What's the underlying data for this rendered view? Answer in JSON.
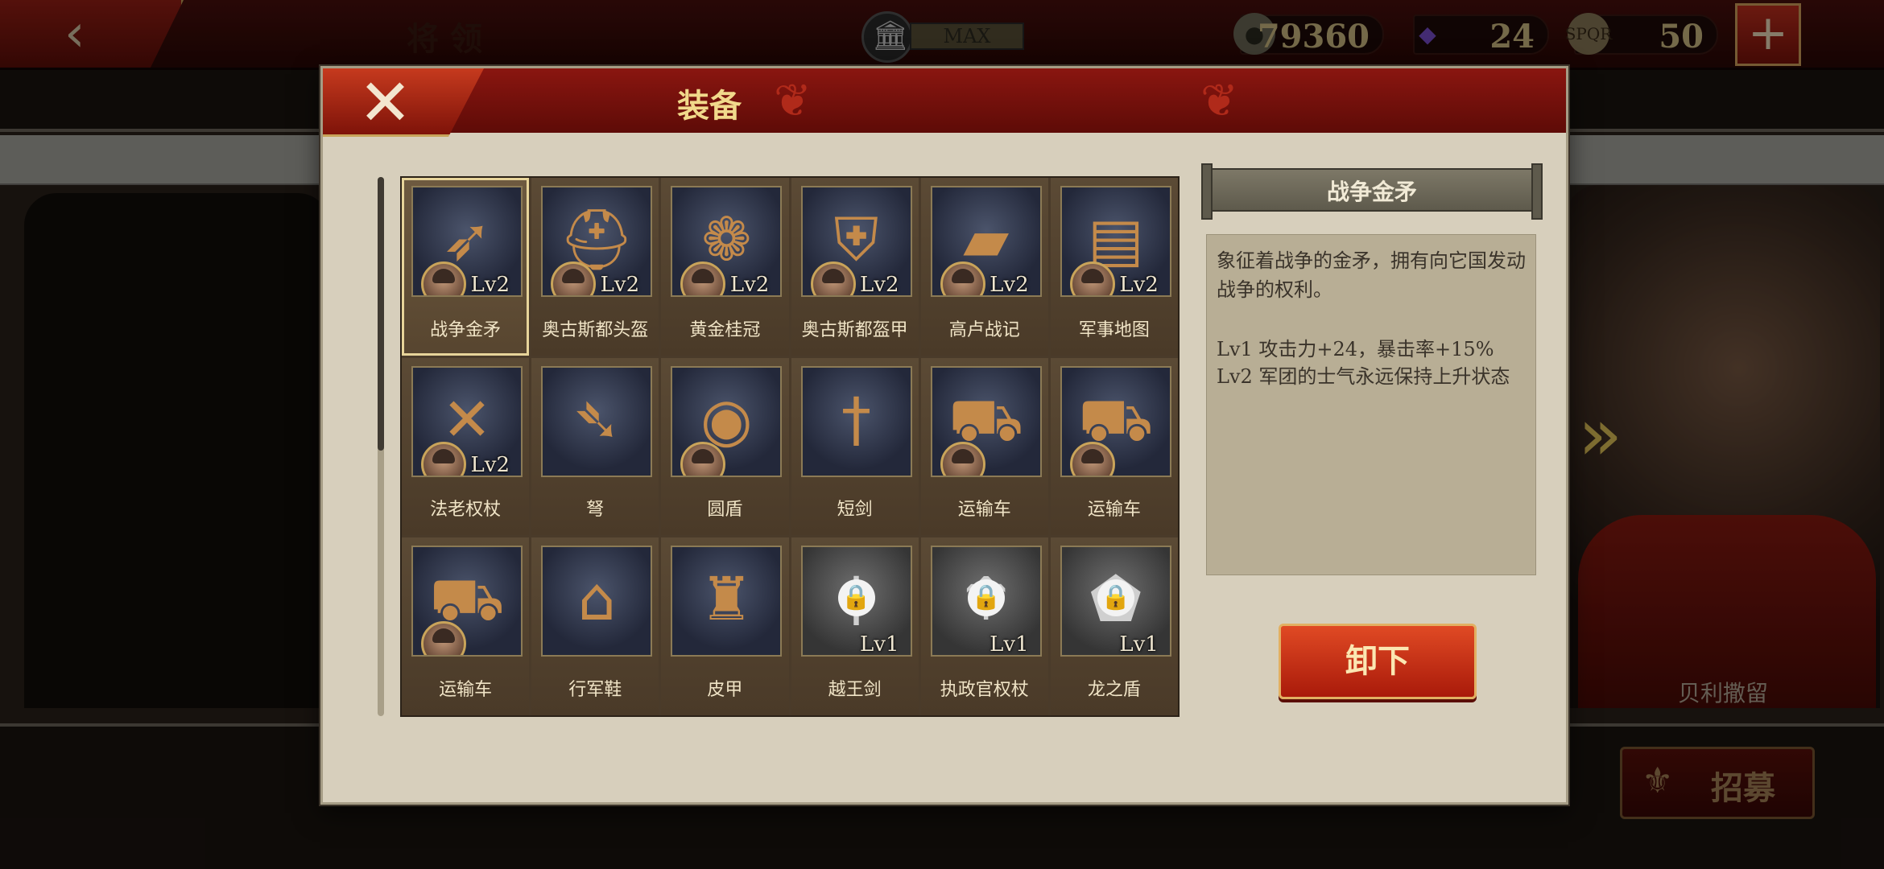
{
  "topbar": {
    "page_title": "将领",
    "max_label": "MAX",
    "resources": [
      {
        "icon": "coin-icon",
        "value": "79360"
      },
      {
        "icon": "gem-icon",
        "value": "24"
      },
      {
        "icon": "spqr-eagle-icon",
        "value": "50"
      }
    ]
  },
  "modal": {
    "title": "装备",
    "items": [
      {
        "label": "战争金矛",
        "level": "Lv2",
        "icon": "spear-icon",
        "has_hero": true,
        "locked": false,
        "selected": true
      },
      {
        "label": "奥古斯都头盔",
        "level": "Lv2",
        "icon": "helmet-icon",
        "has_hero": true,
        "locked": false,
        "selected": false
      },
      {
        "label": "黄金桂冠",
        "level": "Lv2",
        "icon": "laurel-wreath-icon",
        "has_hero": true,
        "locked": false,
        "selected": false
      },
      {
        "label": "奥古斯都盔甲",
        "level": "Lv2",
        "icon": "armor-icon",
        "has_hero": true,
        "locked": false,
        "selected": false
      },
      {
        "label": "高卢战记",
        "level": "Lv2",
        "icon": "book-icon",
        "has_hero": true,
        "locked": false,
        "selected": false
      },
      {
        "label": "军事地图",
        "level": "Lv2",
        "icon": "map-icon",
        "has_hero": true,
        "locked": false,
        "selected": false
      },
      {
        "label": "法老权杖",
        "level": "Lv2",
        "icon": "crook-flail-icon",
        "has_hero": true,
        "locked": false,
        "selected": false
      },
      {
        "label": "弩",
        "level": "",
        "icon": "crossbow-icon",
        "has_hero": false,
        "locked": false,
        "selected": false
      },
      {
        "label": "圆盾",
        "level": "",
        "icon": "round-shield-icon",
        "has_hero": true,
        "locked": false,
        "selected": false
      },
      {
        "label": "短剑",
        "level": "",
        "icon": "short-sword-icon",
        "has_hero": false,
        "locked": false,
        "selected": false
      },
      {
        "label": "运输车",
        "level": "",
        "icon": "supply-cart-icon",
        "has_hero": true,
        "locked": false,
        "selected": false
      },
      {
        "label": "运输车",
        "level": "",
        "icon": "supply-cart-icon",
        "has_hero": true,
        "locked": false,
        "selected": false
      },
      {
        "label": "运输车",
        "level": "",
        "icon": "supply-cart-icon",
        "has_hero": true,
        "locked": false,
        "selected": false
      },
      {
        "label": "行军鞋",
        "level": "",
        "icon": "boots-icon",
        "has_hero": false,
        "locked": false,
        "selected": false
      },
      {
        "label": "皮甲",
        "level": "",
        "icon": "leather-armor-icon",
        "has_hero": false,
        "locked": false,
        "selected": false
      },
      {
        "label": "越王剑",
        "level": "Lv1",
        "icon": "sword-icon",
        "has_hero": false,
        "locked": true,
        "selected": false
      },
      {
        "label": "执政官权杖",
        "level": "Lv1",
        "icon": "eagle-scepter-icon",
        "has_hero": false,
        "locked": true,
        "selected": false
      },
      {
        "label": "龙之盾",
        "level": "Lv1",
        "icon": "dragon-shield-icon",
        "has_hero": false,
        "locked": true,
        "selected": false
      }
    ],
    "detail": {
      "title": "战争金矛",
      "description": "象征着战争的金矛，拥有向它国发动战争的权利。",
      "levels": [
        "Lv1  攻击力+24，暴击率+15%",
        "Lv2  军团的士气永远保持上升状态"
      ]
    },
    "unequip_label": "卸下"
  },
  "background": {
    "hero_name": "贝利撒留",
    "recruit_label": "招募"
  }
}
